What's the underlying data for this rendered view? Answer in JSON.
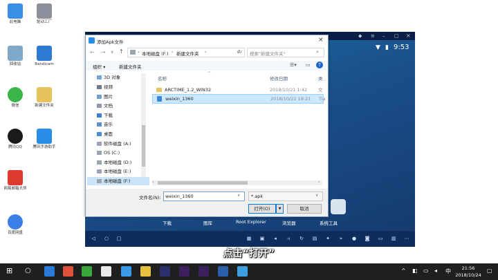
{
  "desktop": {
    "icons": [
      {
        "label": "此电脑",
        "color": "#3a8ee6"
      },
      {
        "label": "驱动工厂",
        "color": "#8a8f99"
      },
      {
        "label": "回收站",
        "color": "#7fa8c9"
      },
      {
        "label": "Bandicam",
        "color": "#2f7bd4"
      },
      {
        "label": "微信",
        "color": "#39b54a"
      },
      {
        "label": "新建文件夹",
        "color": "#e8c25a"
      },
      {
        "label": "腾讯QQ",
        "color": "#1a1a1a"
      },
      {
        "label": "腾讯手游助手",
        "color": "#2a8ee8"
      },
      {
        "label": "网易邮箱大师",
        "color": "#e03a2f"
      },
      {
        "label": "百度网盘",
        "color": "#3b7ee8"
      }
    ]
  },
  "emulator": {
    "status_time": "9:53",
    "tabs": [
      "下载",
      "图库",
      "Root Explorer",
      "浏览器",
      "系统工具"
    ]
  },
  "dialog": {
    "title": "添加Apk文件",
    "path": [
      "本地磁盘 (F:)",
      "新建文件夹"
    ],
    "search_placeholder": "搜索\"新建文件夹\"",
    "organize_label": "组织 ▾",
    "new_folder_label": "新建文件夹",
    "tree": [
      "3D 对象",
      "视频",
      "图片",
      "文档",
      "下载",
      "音乐",
      "桌面",
      "软件磁盘 (A:)",
      "OS (C:)",
      "本地磁盘 (D:)",
      "本地磁盘 (E:)",
      "本地磁盘 (F:)"
    ],
    "columns": {
      "name": "名称",
      "date": "修改日期",
      "type": "类"
    },
    "files": [
      {
        "name": "ARCTIME_1.2_WIN32",
        "date": "2018/10/21 1:42",
        "type": "文"
      },
      {
        "name": "weixin_1360",
        "date": "2018/10/22 19:21",
        "type": "Tia"
      }
    ],
    "filename_label": "文件名(N):",
    "filename_value": "weixin_1360",
    "filter_value": "*.apk",
    "open_label": "打开(O)",
    "cancel_label": "取消"
  },
  "subtitle": "点击“打开”",
  "taskbar": {
    "ime": "中",
    "time": "21:56",
    "date": "2018/10/24",
    "apps": [
      {
        "name": "edge",
        "color": "#2a7ad8"
      },
      {
        "name": "baidu",
        "color": "#e0503a"
      },
      {
        "name": "utorrent",
        "color": "#38a83a"
      },
      {
        "name": "player",
        "color": "#e9e9e9"
      },
      {
        "name": "tencent-meeting",
        "color": "#3a9ae8"
      },
      {
        "name": "notes",
        "color": "#e8c040"
      },
      {
        "name": "photoshop",
        "color": "#2b2f6b"
      },
      {
        "name": "premiere",
        "color": "#3e1f5e"
      },
      {
        "name": "aftereffects",
        "color": "#3b1f5e"
      },
      {
        "name": "window",
        "color": "#2a5ea8"
      },
      {
        "name": "emulator",
        "color": "#3ea0e0"
      }
    ]
  }
}
